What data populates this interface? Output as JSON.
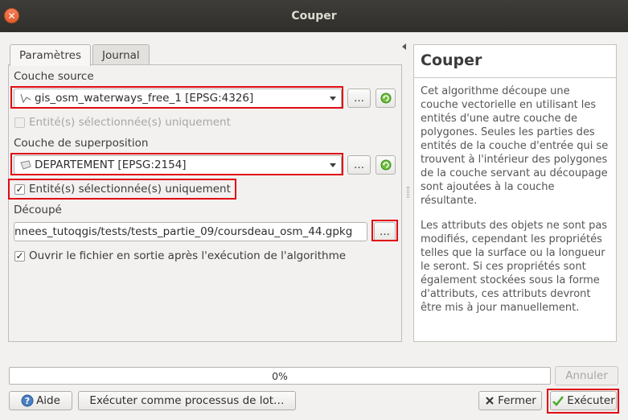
{
  "window": {
    "title": "Couper"
  },
  "tabs": [
    {
      "label": "Paramètres",
      "active": true
    },
    {
      "label": "Journal",
      "active": false
    }
  ],
  "form": {
    "source_label": "Couche source",
    "source_value": "gis_osm_waterways_free_1 [EPSG:4326]",
    "source_selected_only_label": "Entité(s) sélectionnée(s) uniquement",
    "source_selected_only_checked": false,
    "overlay_label": "Couche de superposition",
    "overlay_value": "DEPARTEMENT [EPSG:2154]",
    "overlay_selected_only_label": "Entité(s) sélectionnée(s) uniquement",
    "overlay_selected_only_checked": true,
    "output_label": "Découpé",
    "output_value": "nnees_tutoqgis/tests/tests_partie_09/coursdeau_osm_44.gpkg",
    "open_output_label": "Ouvrir le fichier en sortie après l'exécution de l'algorithme",
    "open_output_checked": true,
    "browse_label": "…"
  },
  "help": {
    "title": "Couper",
    "para1": "Cet algorithme découpe une couche vectorielle en utilisant les entités d'une autre couche de polygones. Seules les parties des entités de la couche d'entrée qui se trouvent à l'intérieur des polygones de la couche servant au découpage sont ajoutées à la couche résultante.",
    "para2": "Les attributs des objets ne sont pas modifiés, cependant les propriétés telles que la surface ou la longueur le seront. Si ces propriétés sont également stockées sous la forme d'attributs, ces attributs devront être mis à jour manuellement."
  },
  "progress": {
    "text": "0%",
    "value": 0
  },
  "buttons": {
    "cancel": "Annuler",
    "help": "Aide",
    "batch": "Exécuter comme processus de lot…",
    "close": "Fermer",
    "run": "Exécuter"
  },
  "icons": {
    "close": "close-icon",
    "line_layer": "line-layer-icon",
    "polygon_layer": "polygon-layer-icon",
    "iterate": "iterate-icon",
    "help": "help-icon",
    "close_x": "close-x-icon",
    "run_check": "checkmark-icon"
  },
  "colors": {
    "highlight": "#e00b14",
    "titlebar": "#34332f"
  }
}
